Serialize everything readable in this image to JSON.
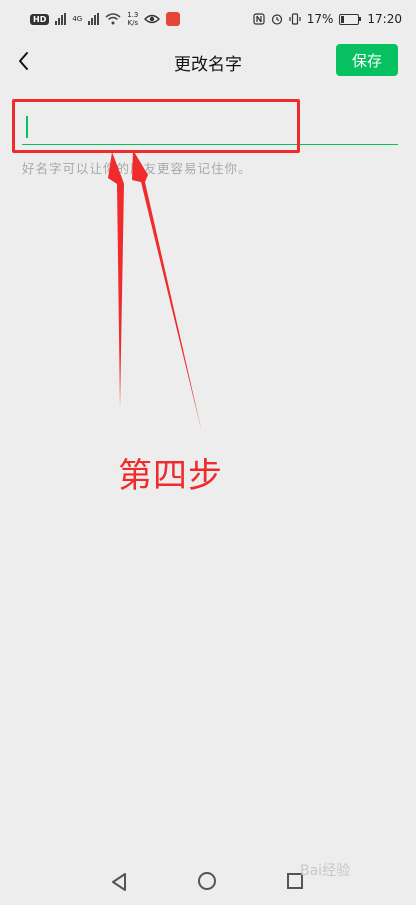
{
  "status_bar": {
    "hd": "HD",
    "network": "4G",
    "speed_value": "1.3",
    "speed_unit": "K/s",
    "battery": "17%",
    "time": "17:20",
    "icons": [
      "nfc-icon",
      "alarm-icon",
      "vibrate-icon",
      "eye-icon"
    ]
  },
  "header": {
    "title": "更改名字",
    "save_label": "保存"
  },
  "form": {
    "name_value": "",
    "hint": "好名字可以让你的朋友更容易记住你。"
  },
  "annotation": {
    "step_label": "第四步",
    "color": "#f02b2b"
  },
  "watermark": "Bai经验",
  "colors": {
    "accent": "#07c160",
    "background": "#ededed"
  }
}
